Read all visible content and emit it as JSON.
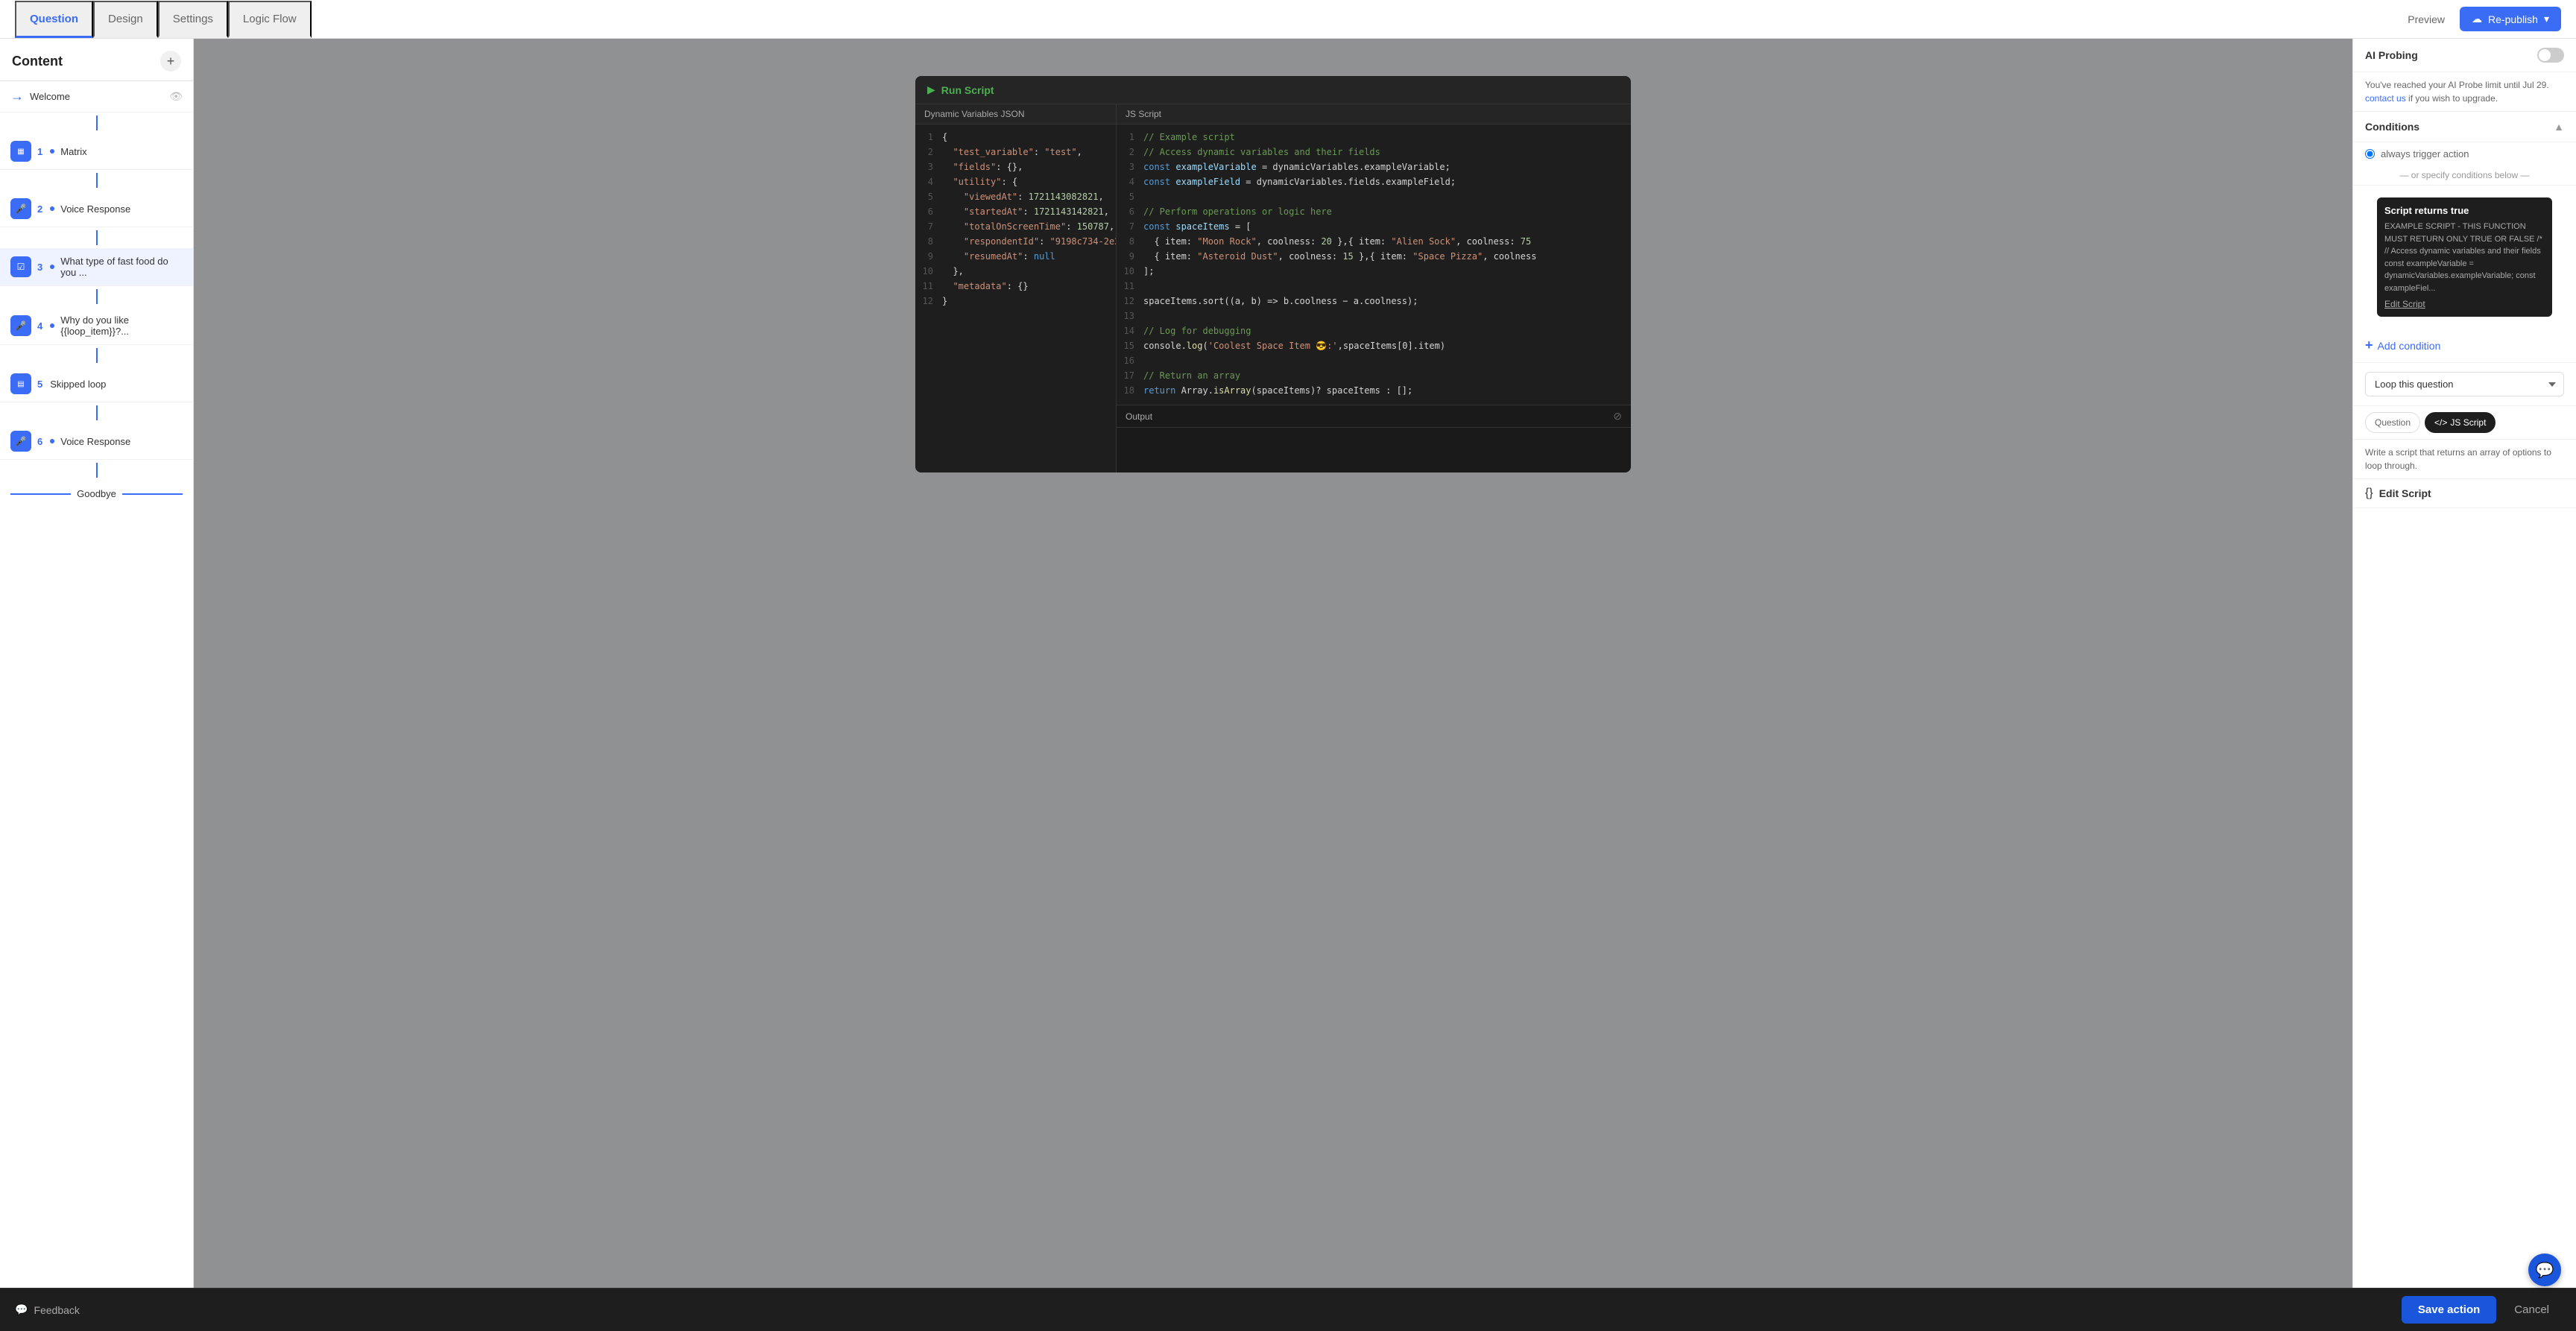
{
  "header": {
    "preview_label": "Preview",
    "republish_label": "Re-publish",
    "tabs": [
      {
        "id": "question",
        "label": "Question",
        "active": true
      },
      {
        "id": "design",
        "label": "Design",
        "active": false
      },
      {
        "id": "settings",
        "label": "Settings",
        "active": false
      },
      {
        "id": "logic_flow",
        "label": "Logic Flow",
        "active": false
      }
    ]
  },
  "sidebar": {
    "title": "Content",
    "items": [
      {
        "id": "welcome",
        "type": "connector",
        "label": "Welcome",
        "num": null
      },
      {
        "id": "matrix-1",
        "type": "matrix",
        "label": "Matrix",
        "num": 1
      },
      {
        "id": "voice-2",
        "type": "mic",
        "label": "Voice Response",
        "num": 2
      },
      {
        "id": "fastfood-3",
        "type": "check",
        "label": "What type of fast food do you ...",
        "num": 3
      },
      {
        "id": "why-4",
        "type": "mic",
        "label": "Why do you like {{loop_item}}?...",
        "num": 4
      },
      {
        "id": "skip-5",
        "type": "grid",
        "label": "Skipped loop",
        "num": 5
      },
      {
        "id": "voice-6",
        "type": "mic",
        "label": "Voice Response",
        "num": 6
      },
      {
        "id": "goodbye",
        "type": "connector",
        "label": "Goodbye",
        "num": null
      }
    ]
  },
  "modal": {
    "run_label": "Run Script",
    "json_panel_title": "Dynamic Variables JSON",
    "js_panel_title": "JS Script",
    "output_label": "Output",
    "json_lines": [
      {
        "num": 1,
        "text": "{"
      },
      {
        "num": 2,
        "text": "  \"test_variable\": \"test\","
      },
      {
        "num": 3,
        "text": "  \"fields\": {},"
      },
      {
        "num": 4,
        "text": "  \"utility\": {"
      },
      {
        "num": 5,
        "text": "    \"viewedAt\": 1721143082821,"
      },
      {
        "num": 6,
        "text": "    \"startedAt\": 1721143142821,"
      },
      {
        "num": 7,
        "text": "    \"totalOnScreenTime\": 150787,"
      },
      {
        "num": 8,
        "text": "    \"respondentId\": \"9198c734-2e2..."
      },
      {
        "num": 9,
        "text": "    \"resumedAt\": null"
      },
      {
        "num": 10,
        "text": "  },"
      },
      {
        "num": 11,
        "text": "  \"metadata\": {}"
      },
      {
        "num": 12,
        "text": "}"
      }
    ],
    "js_lines": [
      {
        "num": 1,
        "text": "// Example script"
      },
      {
        "num": 2,
        "text": "// Access dynamic variables and their fields"
      },
      {
        "num": 3,
        "text": "const exampleVariable = dynamicVariables.exampleVariable;"
      },
      {
        "num": 4,
        "text": "const exampleField = dynamicVariables.fields.exampleField;"
      },
      {
        "num": 5,
        "text": ""
      },
      {
        "num": 6,
        "text": "// Perform operations or logic here"
      },
      {
        "num": 7,
        "text": "const spaceItems = ["
      },
      {
        "num": 8,
        "text": "  { item: \"Moon Rock\", coolness: 20 },{ item: \"Alien Sock\", coolness: 75"
      },
      {
        "num": 9,
        "text": "  { item: \"Asteroid Dust\", coolness: 15 },{ item: \"Space Pizza\", coolness"
      },
      {
        "num": 10,
        "text": "];"
      },
      {
        "num": 11,
        "text": ""
      },
      {
        "num": 12,
        "text": "spaceItems.sort((a, b) => b.coolness - a.coolness);"
      },
      {
        "num": 13,
        "text": ""
      },
      {
        "num": 14,
        "text": "// Log for debugging"
      },
      {
        "num": 15,
        "text": "console.log('Coolest Space Item 😎:',spaceItems[0].item)"
      },
      {
        "num": 16,
        "text": ""
      },
      {
        "num": 17,
        "text": "// Return an array"
      },
      {
        "num": 18,
        "text": "return Array.isArray(spaceItems)? spaceItems : [];"
      }
    ]
  },
  "right_panel": {
    "ai_probe_label": "AI Probing",
    "ai_probe_message": "You've reached your AI Probe limit until Jul 29.",
    "ai_probe_link": "contact us",
    "ai_probe_link2": "if you wish to upgrade.",
    "conditions_title": "tions",
    "always_trigger": "always trigger action",
    "or_specify": "— or specify conditions below —",
    "script_returns_title": "Script returns true",
    "script_returns_text": "EXAMPLE SCRIPT - THIS FUNCTION MUST RETURN ONLY TRUE OR FALSE /* // Access dynamic variables and their fields const exampleVariable = dynamicVariables.exampleVariable; const exampleFiel...",
    "edit_script": "Edit Script",
    "add_condition": "dd condition",
    "loop_dropdown_value": "oop this question",
    "tab_question": "uestion",
    "tab_js_script": "JS Script",
    "loop_description": "Write a script that returns an array of options to loop through.",
    "edit_script_bottom": "Edit Script",
    "save_action": "Save action",
    "cancel": "Cancel",
    "feedback": "Feedback"
  },
  "colors": {
    "accent": "#3b6cf6",
    "dark": "#1e1e1e",
    "green": "#4CAF50"
  }
}
